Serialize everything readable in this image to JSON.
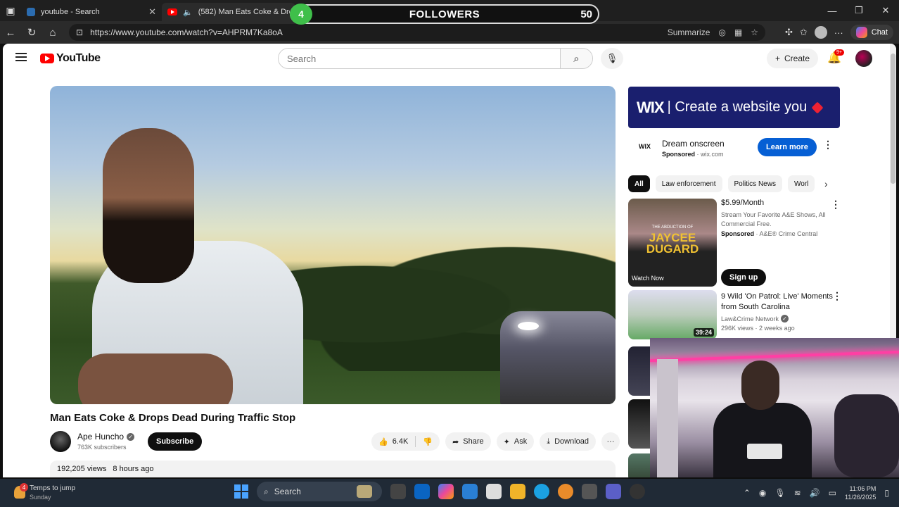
{
  "browser": {
    "tabs": [
      {
        "label": "youtube - Search",
        "active": false
      },
      {
        "label": "(582) Man Eats Coke & Drops Dead During Traffic Stop",
        "active": true
      }
    ],
    "url": "https://www.youtube.com/watch?v=AHPRM7Ka8oA",
    "summarize_label": "Summarize",
    "chat_label": "Chat"
  },
  "followers_overlay": {
    "badge": "4",
    "title": "FOLLOWERS",
    "count": "50"
  },
  "youtube": {
    "logo_text": "YouTube",
    "search_placeholder": "Search",
    "create_label": "Create",
    "notifications_badge": "9+"
  },
  "video": {
    "title": "Man Eats Coke & Drops Dead During Traffic Stop",
    "channel": "Ape Huncho",
    "subscribers": "763K subscribers",
    "subscribe_label": "Subscribe",
    "likes": "6.4K",
    "share_label": "Share",
    "ask_label": "Ask",
    "download_label": "Download",
    "views": "192,205 views",
    "uploaded": "8 hours ago"
  },
  "sidebar": {
    "ad_banner": {
      "brand": "WIX",
      "text": "| Create a website you"
    },
    "ad": {
      "logo": "WIX",
      "title": "Dream onscreen",
      "sponsored": "Sponsored",
      "domain": "wix.com",
      "cta": "Learn more"
    },
    "chips": [
      "All",
      "Law enforcement",
      "Politics News",
      "Worl"
    ],
    "promo": {
      "thumb_kicker": "THE ABDUCTION OF",
      "thumb_title": "JAYCEE DUGARD",
      "thumb_cta": "Watch Now",
      "price": "$5.99/Month",
      "desc": "Stream Your Favorite A&E Shows, All Commercial Free.",
      "sponsored": "Sponsored",
      "advertiser": "A&E® Crime Central",
      "cta": "Sign up"
    },
    "rec": {
      "title": "9 Wild 'On Patrol: Live' Moments from South Carolina",
      "channel": "Law&Crime Network",
      "views": "296K views",
      "age": "2 weeks ago",
      "duration": "39:24"
    }
  },
  "taskbar": {
    "weather_badge": "4",
    "weather_line1": "Temps to jump",
    "weather_line2": "Sunday",
    "search_label": "Search",
    "time": "11:06 PM",
    "date": "11/26/2025"
  },
  "colors": {
    "yt_red": "#ff0000",
    "wix_navy": "#1a1f6e",
    "learn_blue": "#065fd4",
    "followers_green": "#3fbf4a"
  }
}
